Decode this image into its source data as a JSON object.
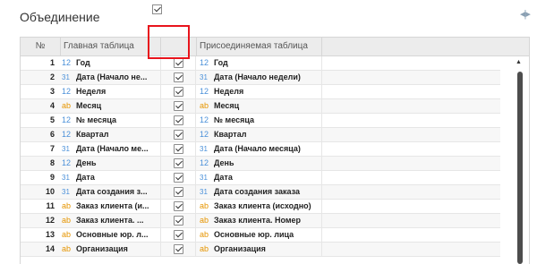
{
  "panel": {
    "title": "Объединение"
  },
  "grid": {
    "headers": {
      "num": "№",
      "main": "Главная таблица",
      "joined": "Присоединяемая таблица"
    },
    "rows": [
      {
        "num": "1",
        "main_type": "number",
        "main": "Год",
        "joined_type": "number",
        "joined": "Год"
      },
      {
        "num": "2",
        "main_type": "date",
        "main": "Дата (Начало не...",
        "joined_type": "date",
        "joined": "Дата (Начало недели)"
      },
      {
        "num": "3",
        "main_type": "number",
        "main": "Неделя",
        "joined_type": "number",
        "joined": "Неделя"
      },
      {
        "num": "4",
        "main_type": "text",
        "main": "Месяц",
        "joined_type": "text",
        "joined": "Месяц"
      },
      {
        "num": "5",
        "main_type": "number",
        "main": "№ месяца",
        "joined_type": "number",
        "joined": "№ месяца"
      },
      {
        "num": "6",
        "main_type": "number",
        "main": "Квартал",
        "joined_type": "number",
        "joined": "Квартал"
      },
      {
        "num": "7",
        "main_type": "date",
        "main": "Дата (Начало ме...",
        "joined_type": "date",
        "joined": "Дата (Начало месяца)"
      },
      {
        "num": "8",
        "main_type": "number",
        "main": "День",
        "joined_type": "number",
        "joined": "День"
      },
      {
        "num": "9",
        "main_type": "date",
        "main": "Дата",
        "joined_type": "date",
        "joined": "Дата"
      },
      {
        "num": "10",
        "main_type": "date",
        "main": "Дата создания з...",
        "joined_type": "date",
        "joined": "Дата создания заказа"
      },
      {
        "num": "11",
        "main_type": "text",
        "main": "Заказ клиента (и...",
        "joined_type": "text",
        "joined": "Заказ клиента (исходно)"
      },
      {
        "num": "12",
        "main_type": "text",
        "main": "Заказ клиента. ...",
        "joined_type": "text",
        "joined": "Заказ клиента. Номер"
      },
      {
        "num": "13",
        "main_type": "text",
        "main": "Основные юр. л...",
        "joined_type": "text",
        "joined": "Основные юр. лица"
      },
      {
        "num": "14",
        "main_type": "text",
        "main": "Организация",
        "joined_type": "text",
        "joined": "Организация"
      }
    ]
  },
  "type_icons": {
    "number": "12",
    "text": "ab",
    "date": "31"
  },
  "colors": {
    "highlight": "#e8141c",
    "number_icon": "#4a90d9",
    "text_icon": "#e69500"
  }
}
